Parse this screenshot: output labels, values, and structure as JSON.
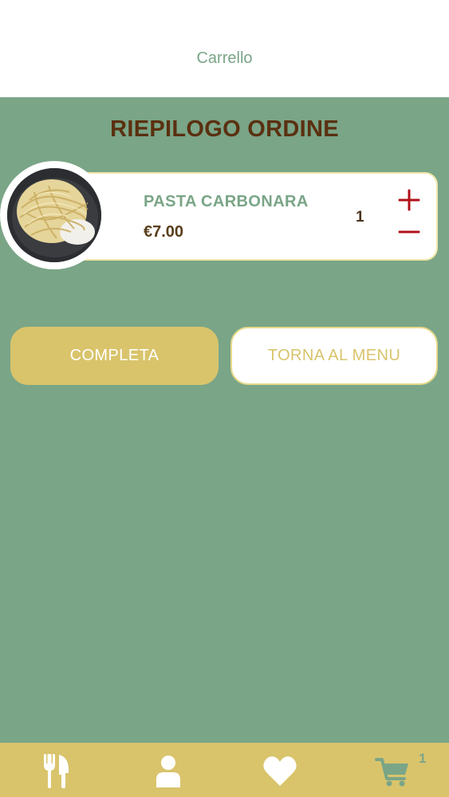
{
  "header": {
    "title": "Carrello"
  },
  "summary": {
    "title": "RIEPILOGO ORDINE"
  },
  "cart_items": [
    {
      "name": "PASTA CARBONARA",
      "price": "€7.00",
      "quantity": "1"
    }
  ],
  "actions": {
    "complete_label": "COMPLETA",
    "back_label": "TORNA AL MENU"
  },
  "tabbar": {
    "items": [
      {
        "icon": "fork-knife-icon"
      },
      {
        "icon": "user-icon"
      },
      {
        "icon": "heart-icon"
      },
      {
        "icon": "cart-icon"
      }
    ],
    "cart_badge": "1"
  },
  "colors": {
    "background": "#7aa587",
    "accent": "#d9c46c",
    "title": "#5a3010",
    "quantity_controls": "#b0101a"
  }
}
